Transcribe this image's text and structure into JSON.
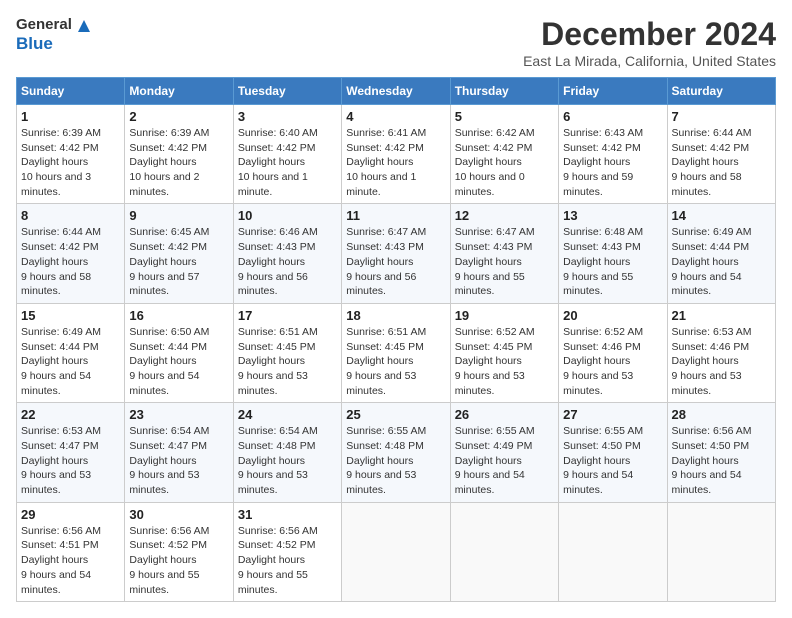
{
  "header": {
    "logo_general": "General",
    "logo_blue": "Blue",
    "title": "December 2024",
    "subtitle": "East La Mirada, California, United States"
  },
  "weekdays": [
    "Sunday",
    "Monday",
    "Tuesday",
    "Wednesday",
    "Thursday",
    "Friday",
    "Saturday"
  ],
  "weeks": [
    [
      {
        "day": 1,
        "sunrise": "6:39 AM",
        "sunset": "4:42 PM",
        "daylight": "10 hours and 3 minutes."
      },
      {
        "day": 2,
        "sunrise": "6:39 AM",
        "sunset": "4:42 PM",
        "daylight": "10 hours and 2 minutes."
      },
      {
        "day": 3,
        "sunrise": "6:40 AM",
        "sunset": "4:42 PM",
        "daylight": "10 hours and 1 minute."
      },
      {
        "day": 4,
        "sunrise": "6:41 AM",
        "sunset": "4:42 PM",
        "daylight": "10 hours and 1 minute."
      },
      {
        "day": 5,
        "sunrise": "6:42 AM",
        "sunset": "4:42 PM",
        "daylight": "10 hours and 0 minutes."
      },
      {
        "day": 6,
        "sunrise": "6:43 AM",
        "sunset": "4:42 PM",
        "daylight": "9 hours and 59 minutes."
      },
      {
        "day": 7,
        "sunrise": "6:44 AM",
        "sunset": "4:42 PM",
        "daylight": "9 hours and 58 minutes."
      }
    ],
    [
      {
        "day": 8,
        "sunrise": "6:44 AM",
        "sunset": "4:42 PM",
        "daylight": "9 hours and 58 minutes."
      },
      {
        "day": 9,
        "sunrise": "6:45 AM",
        "sunset": "4:42 PM",
        "daylight": "9 hours and 57 minutes."
      },
      {
        "day": 10,
        "sunrise": "6:46 AM",
        "sunset": "4:43 PM",
        "daylight": "9 hours and 56 minutes."
      },
      {
        "day": 11,
        "sunrise": "6:47 AM",
        "sunset": "4:43 PM",
        "daylight": "9 hours and 56 minutes."
      },
      {
        "day": 12,
        "sunrise": "6:47 AM",
        "sunset": "4:43 PM",
        "daylight": "9 hours and 55 minutes."
      },
      {
        "day": 13,
        "sunrise": "6:48 AM",
        "sunset": "4:43 PM",
        "daylight": "9 hours and 55 minutes."
      },
      {
        "day": 14,
        "sunrise": "6:49 AM",
        "sunset": "4:44 PM",
        "daylight": "9 hours and 54 minutes."
      }
    ],
    [
      {
        "day": 15,
        "sunrise": "6:49 AM",
        "sunset": "4:44 PM",
        "daylight": "9 hours and 54 minutes."
      },
      {
        "day": 16,
        "sunrise": "6:50 AM",
        "sunset": "4:44 PM",
        "daylight": "9 hours and 54 minutes."
      },
      {
        "day": 17,
        "sunrise": "6:51 AM",
        "sunset": "4:45 PM",
        "daylight": "9 hours and 53 minutes."
      },
      {
        "day": 18,
        "sunrise": "6:51 AM",
        "sunset": "4:45 PM",
        "daylight": "9 hours and 53 minutes."
      },
      {
        "day": 19,
        "sunrise": "6:52 AM",
        "sunset": "4:45 PM",
        "daylight": "9 hours and 53 minutes."
      },
      {
        "day": 20,
        "sunrise": "6:52 AM",
        "sunset": "4:46 PM",
        "daylight": "9 hours and 53 minutes."
      },
      {
        "day": 21,
        "sunrise": "6:53 AM",
        "sunset": "4:46 PM",
        "daylight": "9 hours and 53 minutes."
      }
    ],
    [
      {
        "day": 22,
        "sunrise": "6:53 AM",
        "sunset": "4:47 PM",
        "daylight": "9 hours and 53 minutes."
      },
      {
        "day": 23,
        "sunrise": "6:54 AM",
        "sunset": "4:47 PM",
        "daylight": "9 hours and 53 minutes."
      },
      {
        "day": 24,
        "sunrise": "6:54 AM",
        "sunset": "4:48 PM",
        "daylight": "9 hours and 53 minutes."
      },
      {
        "day": 25,
        "sunrise": "6:55 AM",
        "sunset": "4:48 PM",
        "daylight": "9 hours and 53 minutes."
      },
      {
        "day": 26,
        "sunrise": "6:55 AM",
        "sunset": "4:49 PM",
        "daylight": "9 hours and 54 minutes."
      },
      {
        "day": 27,
        "sunrise": "6:55 AM",
        "sunset": "4:50 PM",
        "daylight": "9 hours and 54 minutes."
      },
      {
        "day": 28,
        "sunrise": "6:56 AM",
        "sunset": "4:50 PM",
        "daylight": "9 hours and 54 minutes."
      }
    ],
    [
      {
        "day": 29,
        "sunrise": "6:56 AM",
        "sunset": "4:51 PM",
        "daylight": "9 hours and 54 minutes."
      },
      {
        "day": 30,
        "sunrise": "6:56 AM",
        "sunset": "4:52 PM",
        "daylight": "9 hours and 55 minutes."
      },
      {
        "day": 31,
        "sunrise": "6:56 AM",
        "sunset": "4:52 PM",
        "daylight": "9 hours and 55 minutes."
      },
      null,
      null,
      null,
      null
    ]
  ],
  "labels": {
    "sunrise": "Sunrise:",
    "sunset": "Sunset:",
    "daylight": "Daylight hours"
  }
}
